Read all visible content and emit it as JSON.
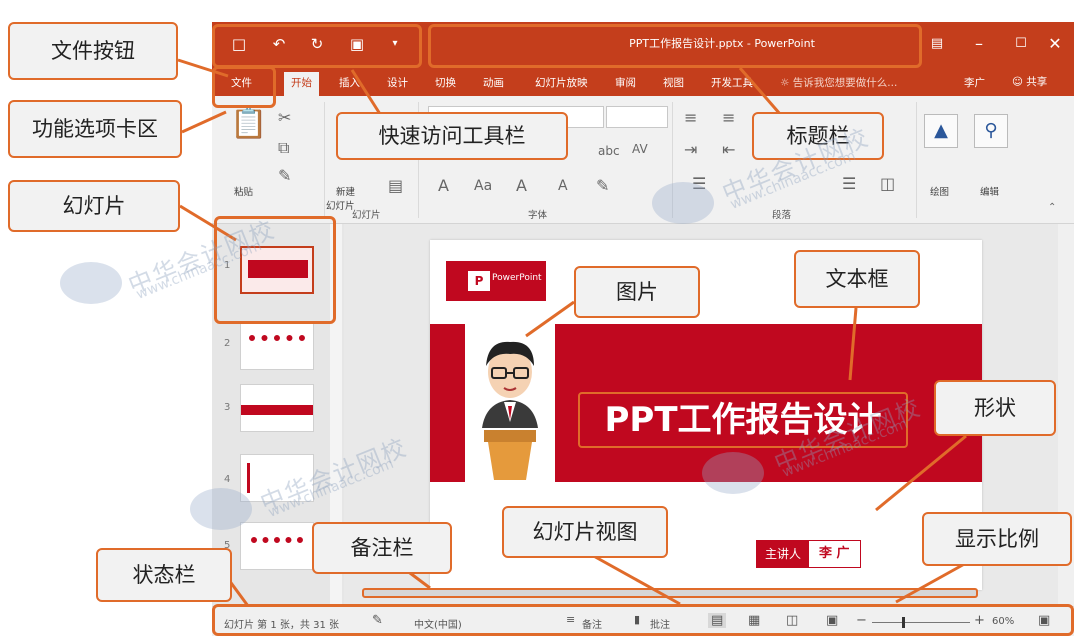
{
  "window": {
    "title": "PPT工作报告设计.pptx - PowerPoint",
    "accent_color": "#c43e1c",
    "quick_access": [
      {
        "icon": "save-icon",
        "glyph": "💾"
      },
      {
        "icon": "undo-icon",
        "glyph": "↶"
      },
      {
        "icon": "redo-icon",
        "glyph": "↻"
      },
      {
        "icon": "present-icon",
        "glyph": "▣"
      },
      {
        "icon": "customize-icon",
        "glyph": "▾"
      }
    ]
  },
  "tabs": [
    "文件",
    "开始",
    "插入",
    "设计",
    "切换",
    "动画",
    "幻灯片放映",
    "审阅",
    "视图",
    "开发工具"
  ],
  "tell_me": "告诉我您想要做什么...",
  "user": "李广",
  "share": "共享",
  "ribbon": {
    "paste": "粘贴",
    "new_slide_line1": "新建",
    "new_slide_line2": "幻灯片",
    "groups": [
      "幻灯片",
      "字体",
      "段落"
    ],
    "draw": "绘图",
    "edit": "编辑"
  },
  "slide": {
    "title": "PPT工作报告设计",
    "logo_text": "PowerPoint",
    "presenter_label": "主讲人",
    "presenter_name": "李 广",
    "brand_color": "#c0081f"
  },
  "thumbnails": [
    {
      "num": "1"
    },
    {
      "num": "2"
    },
    {
      "num": "3"
    },
    {
      "num": "4"
    },
    {
      "num": "5"
    }
  ],
  "status": {
    "slide_info": "幻灯片 第 1 张，共 31 张",
    "language": "中文(中国)",
    "notes": "备注",
    "comments": "批注",
    "zoom": "60%",
    "zoom_value": 0.6
  },
  "callouts": {
    "file_button": "文件按钮",
    "quick_access": "快速访问工具栏",
    "title_bar": "标题栏",
    "ribbon_tabs": "功能选项卡区",
    "slides": "幻灯片",
    "picture": "图片",
    "textbox": "文本框",
    "shape": "形状",
    "slide_view": "幻灯片视图",
    "notes_bar": "备注栏",
    "status_bar": "状态栏",
    "zoom_ratio": "显示比例"
  },
  "watermark": {
    "cn": "中华会计网校",
    "en": "www.chinaacc.com"
  }
}
